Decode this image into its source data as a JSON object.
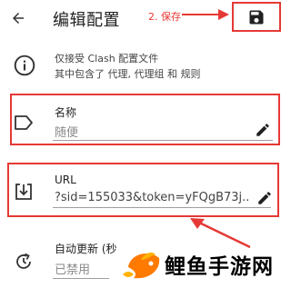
{
  "appbar": {
    "title": "编辑配置",
    "annotation": "2. 保存"
  },
  "info": {
    "line1": "仅接受 Clash 配置文件",
    "line2": "其中包含了 代理, 代理组 和 规则"
  },
  "name_field": {
    "label": "名称",
    "value": "随便"
  },
  "url_field": {
    "label": "URL",
    "value": "?sid=155033&token=yFQgB73j..."
  },
  "auto_update": {
    "label": "自动更新 (秒",
    "value": "已禁用"
  },
  "watermark": {
    "text": "鲤鱼手游网"
  },
  "colors": {
    "annotation_red": "#e53935",
    "icon_dark": "#212121",
    "placeholder_gray": "#8a8a8a"
  }
}
